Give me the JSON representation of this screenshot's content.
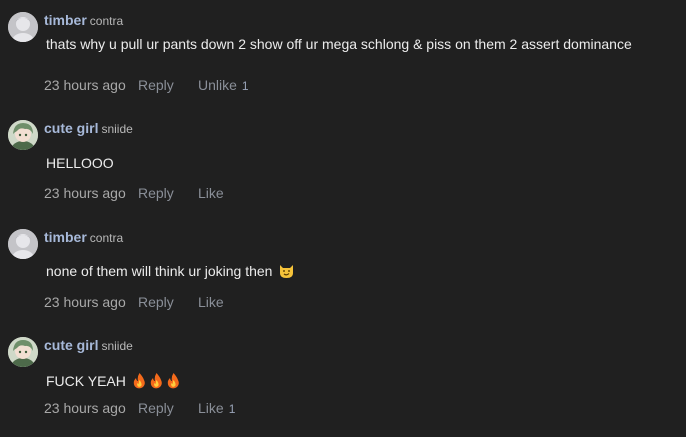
{
  "comments": [
    {
      "user": "timber",
      "handle": "contra",
      "avatar": "gray-avatar",
      "text": "thats why u pull ur pants down 2 show off ur mega schlong & piss on them 2 assert dominance",
      "time": "23 hours ago",
      "reply_label": "Reply",
      "like_label": "Unlike",
      "like_count": "1"
    },
    {
      "user": "cute girl",
      "handle": "sniide",
      "avatar": "anime-avatar",
      "text": "HELLOOO",
      "time": "23 hours ago",
      "reply_label": "Reply",
      "like_label": "Like",
      "like_count": ""
    },
    {
      "user": "timber",
      "handle": "contra",
      "avatar": "gray-avatar",
      "text": "none of them will think ur joking then",
      "emoji": [
        "smirking-cat-emoji"
      ],
      "time": "23 hours ago",
      "reply_label": "Reply",
      "like_label": "Like",
      "like_count": ""
    },
    {
      "user": "cute girl",
      "handle": "sniide",
      "avatar": "anime-avatar",
      "text": "FUCK YEAH",
      "emoji": [
        "fire-emoji",
        "fire-emoji",
        "fire-emoji"
      ],
      "time": "23 hours ago",
      "reply_label": "Reply",
      "like_label": "Like",
      "like_count": "1"
    }
  ],
  "colors": {
    "background": "#202020",
    "username": "#a7b9d9",
    "action": "#8a8f98"
  }
}
